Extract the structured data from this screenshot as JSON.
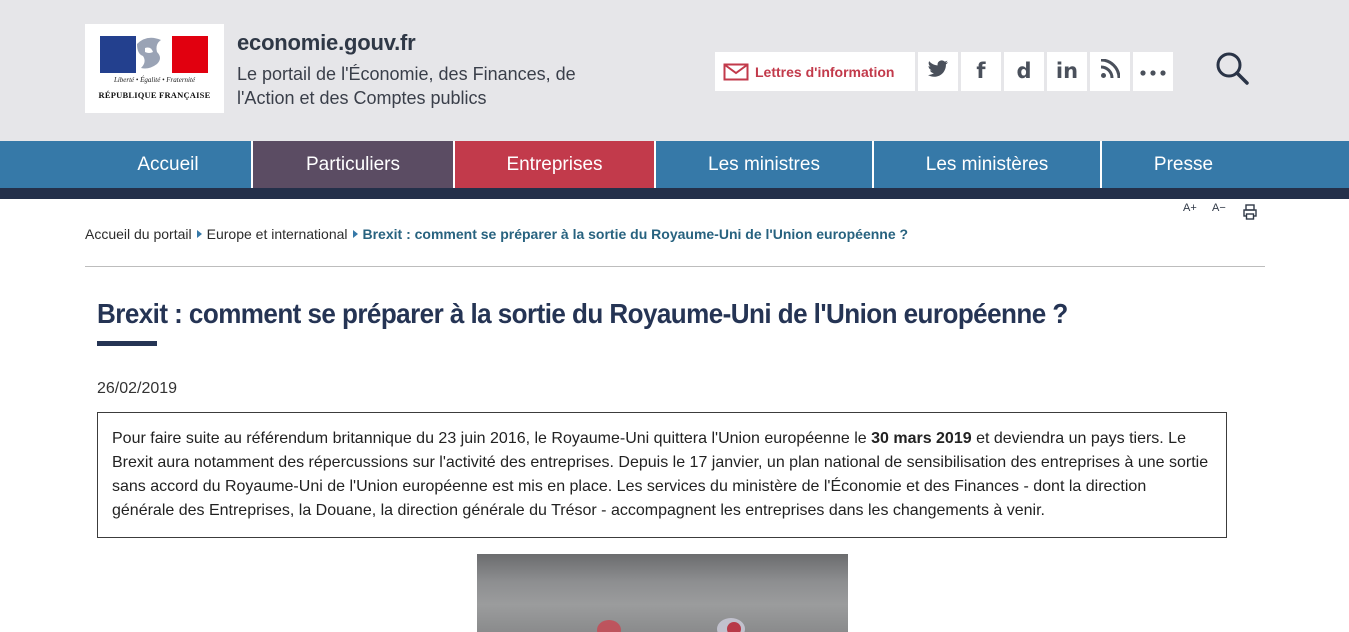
{
  "header": {
    "logo": {
      "motto": "Liberté • Égalité • Fraternité",
      "republic": "RÉPUBLIQUE FRANÇAISE"
    },
    "site_name": "economie.gouv.fr",
    "tagline": "Le portail de l'Économie, des Finances, de l'Action et des Comptes publics",
    "newsletter_label": "Lettres d'information",
    "social": [
      {
        "name": "twitter-icon",
        "glyph": "t"
      },
      {
        "name": "facebook-icon",
        "glyph": "f"
      },
      {
        "name": "dailymotion-icon",
        "glyph": "d"
      },
      {
        "name": "linkedin-icon",
        "glyph": "in"
      },
      {
        "name": "rss-icon",
        "glyph": "rss"
      },
      {
        "name": "more-icon",
        "glyph": "•••"
      }
    ]
  },
  "nav": {
    "items": [
      {
        "label": "Accueil",
        "color": "#3679a8"
      },
      {
        "label": "Particuliers",
        "color": "#5b4c63"
      },
      {
        "label": "Entreprises",
        "color": "#c23a4b"
      },
      {
        "label": "Les ministres",
        "color": "#3679a8"
      },
      {
        "label": "Les ministères",
        "color": "#3679a8"
      },
      {
        "label": "Presse",
        "color": "#3679a8"
      }
    ]
  },
  "tools": {
    "increase_font": "A+",
    "decrease_font": "A−"
  },
  "breadcrumb": {
    "items": [
      "Accueil du portail",
      "Europe et international"
    ],
    "current": "Brexit : comment se préparer à la sortie du Royaume-Uni de l'Union européenne ?"
  },
  "article": {
    "title": "Brexit : comment se préparer à la sortie du Royaume-Uni de l'Union européenne ?",
    "date": "26/02/2019",
    "intro_before_bold": "Pour faire suite au référendum britannique du 23 juin 2016, le Royaume-Uni quittera l'Union européenne le ",
    "intro_bold": "30 mars 2019",
    "intro_after_bold": " et deviendra un pays tiers. Le Brexit aura notamment des répercussions sur l'activité des entreprises. Depuis le 17 janvier, un plan national de sensibilisation des entreprises à une sortie sans accord du Royaume-Uni de l'Union européenne est mis en place. Les services du ministère de l'Économie et des Finances - dont la direction générale des Entreprises, la Douane, la direction générale du Trésor - accompagnent les entreprises dans les changements à venir."
  },
  "colors": {
    "header_bg": "#e6e6e9",
    "nav_blue": "#3679a8",
    "nav_dark": "#24304a",
    "title": "#253454",
    "accent_red": "#c23a4b"
  }
}
